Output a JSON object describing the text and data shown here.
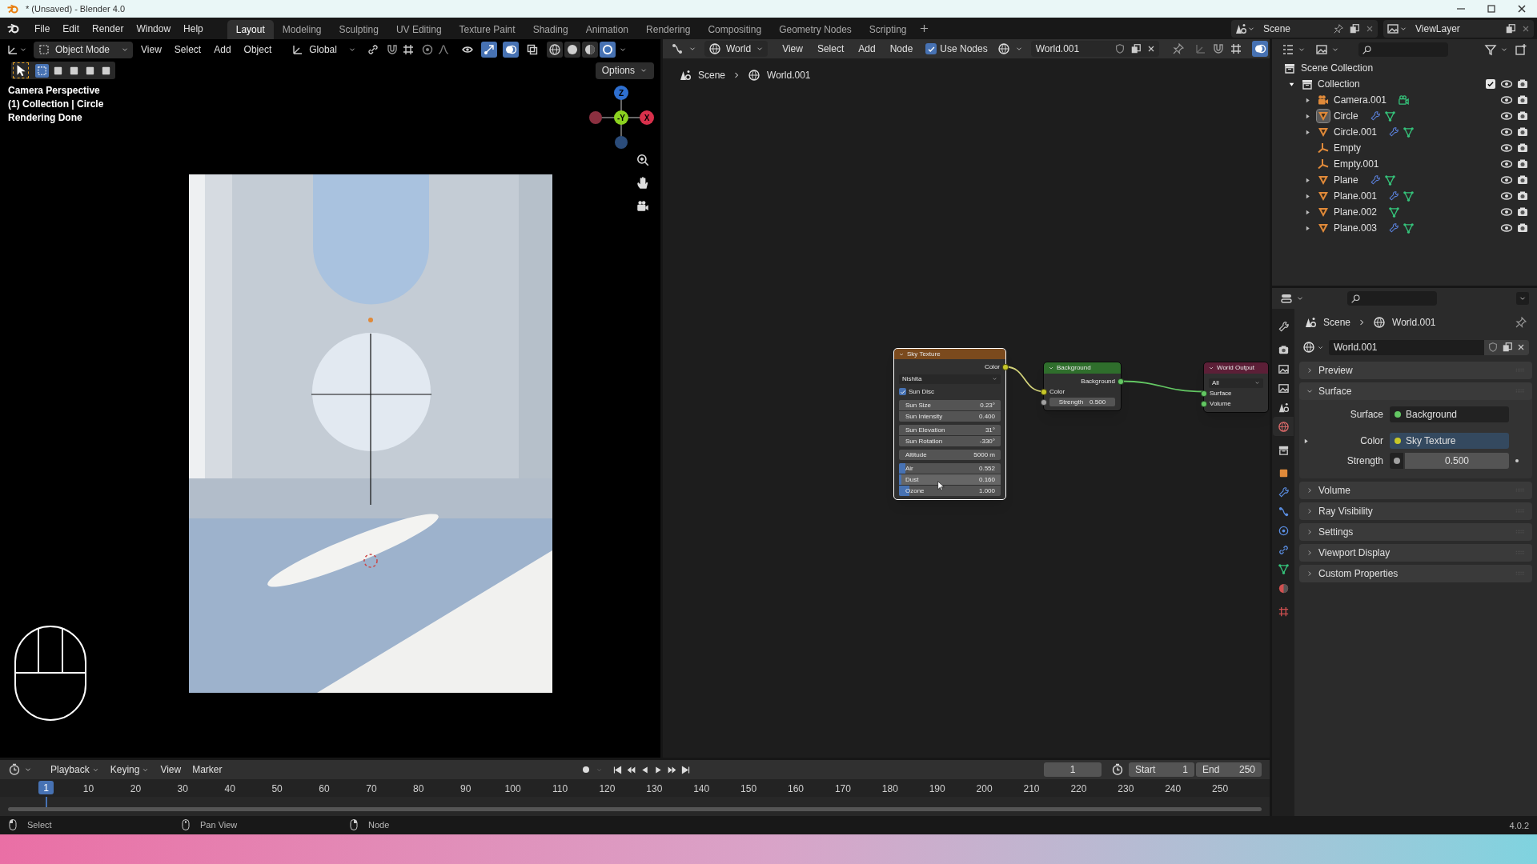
{
  "window": {
    "title": "* (Unsaved) - Blender 4.0"
  },
  "top_bar": {
    "menus": [
      "File",
      "Edit",
      "Render",
      "Window",
      "Help"
    ],
    "workspaces": [
      {
        "label": "Layout",
        "selected": true
      },
      {
        "label": "Modeling",
        "selected": false
      },
      {
        "label": "Sculpting",
        "selected": false
      },
      {
        "label": "UV Editing",
        "selected": false
      },
      {
        "label": "Texture Paint",
        "selected": false
      },
      {
        "label": "Shading",
        "selected": false
      },
      {
        "label": "Animation",
        "selected": false
      },
      {
        "label": "Rendering",
        "selected": false
      },
      {
        "label": "Compositing",
        "selected": false
      },
      {
        "label": "Geometry Nodes",
        "selected": false
      },
      {
        "label": "Scripting",
        "selected": false
      }
    ],
    "scene": "Scene",
    "view_layer": "ViewLayer"
  },
  "viewport": {
    "mode": "Object Mode",
    "menus": [
      "View",
      "Select",
      "Add",
      "Object"
    ],
    "orientation": "Global",
    "toggles": [
      {
        "kind": "visibility",
        "on": false
      },
      {
        "kind": "gizmos",
        "on": true
      },
      {
        "kind": "overlays",
        "on": true
      },
      {
        "kind": "xray",
        "on": false
      }
    ],
    "shading_modes": [
      {
        "kind": "wireframe",
        "selected": false
      },
      {
        "kind": "solid",
        "selected": false
      },
      {
        "kind": "material",
        "selected": false
      },
      {
        "kind": "rendered",
        "selected": true
      }
    ],
    "tools": [
      {
        "kind": "select",
        "selected": true
      }
    ],
    "select_modes": [
      {
        "kind": "new",
        "selected": true
      },
      {
        "kind": "extend",
        "selected": false
      },
      {
        "kind": "subtract",
        "selected": false
      },
      {
        "kind": "invert",
        "selected": false
      },
      {
        "kind": "intersect",
        "selected": false
      }
    ],
    "options": "Options",
    "overlay_text": [
      "Camera Perspective",
      "(1) Collection | Circle",
      "Rendering Done"
    ],
    "axes": [
      {
        "label": "Z",
        "color": "#2e6fd0"
      },
      {
        "label": "-Y",
        "color": "#8bd21f"
      },
      {
        "label": "X",
        "color": "#d8304b"
      }
    ],
    "render": {
      "kind": "picture"
    }
  },
  "node_editor": {
    "editor": "World",
    "menus": [
      "View",
      "Select",
      "Add",
      "Node"
    ],
    "use_nodes": {
      "label": "Use Nodes",
      "checked": true
    },
    "world": "World.001",
    "breadcrumbs": [
      "Scene",
      "World.001"
    ],
    "nodes": [
      {
        "title": "Sky Texture",
        "color": "#7b4a1d",
        "selected": true,
        "rows": [
          {
            "kind": "output",
            "label": "Color",
            "color": "#c7c729"
          },
          {
            "kind": "dropdown",
            "value": "Nishita"
          },
          {
            "kind": "checkbox",
            "label": "Sun Disc",
            "checked": true
          },
          {
            "kind": "fields",
            "fields": [
              {
                "label": "Sun Size",
                "value": "0.23°"
              },
              {
                "label": "Sun Intensity",
                "value": "0.400"
              }
            ]
          },
          {
            "kind": "fields",
            "fields": [
              {
                "label": "Sun Elevation",
                "value": "31°"
              },
              {
                "label": "Sun Rotation",
                "value": "-330°"
              }
            ]
          },
          {
            "kind": "fields",
            "fields": [
              {
                "label": "Altitude",
                "value": "5000 m"
              }
            ]
          },
          {
            "kind": "fields",
            "fields": [
              {
                "label": "Air",
                "value": "0.552",
                "level": 0.06
              },
              {
                "label": "Dust",
                "value": "0.160",
                "level": 0.02
              },
              {
                "label": "Ozone",
                "value": "1.000",
                "level": 0.1
              }
            ]
          }
        ]
      },
      {
        "title": "Background",
        "color": "#2f6e2c",
        "selected": false,
        "rows": [
          {
            "kind": "output",
            "label": "Background",
            "color": "#63c763"
          },
          {
            "kind": "input",
            "label": "Color",
            "color": "#c7c729"
          },
          {
            "kind": "input_field",
            "label": "Strength",
            "value": "0.500",
            "color": "#a1a1a1"
          }
        ]
      },
      {
        "title": "World Output",
        "color": "#5c1f37",
        "selected": false,
        "rows": [
          {
            "kind": "dropdown",
            "value": "All"
          },
          {
            "kind": "input",
            "label": "Surface",
            "color": "#63c763"
          },
          {
            "kind": "input",
            "label": "Volume",
            "color": "#63c763"
          }
        ]
      }
    ]
  },
  "outliner": {
    "root": "Scene Collection",
    "tree": [
      {
        "name": "Collection",
        "kind": "collection",
        "expanded": true,
        "included": true,
        "visible": true,
        "renderable": true,
        "selected": false,
        "children": [
          {
            "name": "Camera.001",
            "kind": "camera",
            "expanded": false,
            "modifier": false,
            "has_data": true,
            "visible": true,
            "renderable": true,
            "selected": false
          },
          {
            "name": "Circle",
            "kind": "mesh",
            "expanded": false,
            "modifier": true,
            "has_data": true,
            "visible": true,
            "renderable": true,
            "selected": true
          },
          {
            "name": "Circle.001",
            "kind": "mesh",
            "expanded": false,
            "modifier": true,
            "has_data": true,
            "visible": true,
            "renderable": true,
            "selected": false
          },
          {
            "name": "Empty",
            "kind": "empty",
            "expanded": false,
            "modifier": false,
            "has_data": false,
            "visible": true,
            "renderable": true,
            "selected": false
          },
          {
            "name": "Empty.001",
            "kind": "empty",
            "expanded": false,
            "modifier": false,
            "has_data": false,
            "visible": true,
            "renderable": true,
            "selected": false
          },
          {
            "name": "Plane",
            "kind": "mesh",
            "expanded": false,
            "modifier": true,
            "has_data": true,
            "visible": true,
            "renderable": true,
            "selected": false
          },
          {
            "name": "Plane.001",
            "kind": "mesh",
            "expanded": false,
            "modifier": true,
            "has_data": true,
            "visible": true,
            "renderable": true,
            "selected": false
          },
          {
            "name": "Plane.002",
            "kind": "mesh",
            "expanded": false,
            "modifier": false,
            "has_data": true,
            "visible": true,
            "renderable": true,
            "selected": false
          },
          {
            "name": "Plane.003",
            "kind": "mesh",
            "expanded": false,
            "modifier": true,
            "has_data": true,
            "visible": true,
            "renderable": true,
            "selected": false
          }
        ]
      }
    ]
  },
  "properties": {
    "tabs": [
      {
        "kind": "tool",
        "selected": false
      },
      {
        "kind": "render",
        "selected": false
      },
      {
        "kind": "output",
        "selected": false
      },
      {
        "kind": "view_layer",
        "selected": false
      },
      {
        "kind": "scene",
        "selected": false
      },
      {
        "kind": "world",
        "selected": true
      },
      {
        "kind": "collection",
        "selected": false
      },
      {
        "kind": "object",
        "selected": false
      },
      {
        "kind": "modifiers",
        "selected": false
      },
      {
        "kind": "particles",
        "selected": false
      },
      {
        "kind": "physics",
        "selected": false
      },
      {
        "kind": "constraints",
        "selected": false
      },
      {
        "kind": "data",
        "selected": false
      },
      {
        "kind": "material",
        "selected": false
      },
      {
        "kind": "texture",
        "selected": false
      }
    ],
    "breadcrumbs": [
      "Scene",
      "World.001"
    ],
    "datablock": "World.001",
    "panels": [
      {
        "title": "Preview",
        "expanded": false
      },
      {
        "title": "Surface",
        "expanded": true,
        "props": [
          {
            "kind": "node",
            "label": "Surface",
            "value": "Background",
            "color": "#63c763"
          },
          {
            "kind": "linked_node",
            "label": "Color",
            "value": "Sky Texture",
            "color": "#c7c729"
          },
          {
            "kind": "number",
            "label": "Strength",
            "value": "0.500",
            "color": "#a1a1a1"
          }
        ]
      },
      {
        "title": "Volume",
        "expanded": false
      },
      {
        "title": "Ray Visibility",
        "expanded": false
      },
      {
        "title": "Settings",
        "expanded": false
      },
      {
        "title": "Viewport Display",
        "expanded": false
      },
      {
        "title": "Custom Properties",
        "expanded": false
      }
    ]
  },
  "timeline": {
    "menus": [
      "Playback",
      "Keying",
      "View",
      "Marker"
    ],
    "current_frame": "1",
    "start": {
      "label": "Start",
      "value": "1"
    },
    "end": {
      "label": "End",
      "value": "250"
    },
    "playhead": "1",
    "ruler": [
      "10",
      "20",
      "30",
      "40",
      "50",
      "60",
      "70",
      "80",
      "90",
      "100",
      "110",
      "120",
      "130",
      "140",
      "150",
      "160",
      "170",
      "180",
      "190",
      "200",
      "210",
      "220",
      "230",
      "240",
      "250"
    ]
  },
  "status_bar": {
    "items": [
      {
        "label": "Select",
        "kind": "left"
      },
      {
        "label": "Pan View",
        "kind": "middle"
      },
      {
        "label": "Node",
        "kind": "right"
      }
    ],
    "version": "4.0.2"
  }
}
